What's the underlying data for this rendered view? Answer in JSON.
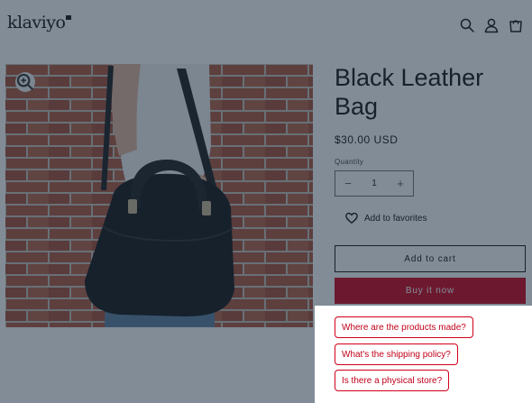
{
  "header": {
    "logo_text": "klaviyo",
    "icons": [
      "search-icon",
      "account-icon",
      "cart-icon"
    ]
  },
  "product": {
    "title": "Black Leather Bag",
    "price": "$30.00 USD",
    "quantity_label": "Quantity",
    "quantity_value": "1",
    "decrease_symbol": "−",
    "increase_symbol": "+",
    "favorite_label": "Add to favorites",
    "add_to_cart_label": "Add to cart",
    "buy_now_label": "Buy it now"
  },
  "chat": {
    "suggestions": [
      "Where are the products made?",
      "What's the shipping policy?",
      "Is there a physical store?"
    ]
  },
  "colors": {
    "accent": "#d0001a",
    "overlay": "#192d41",
    "text": "#121212"
  }
}
